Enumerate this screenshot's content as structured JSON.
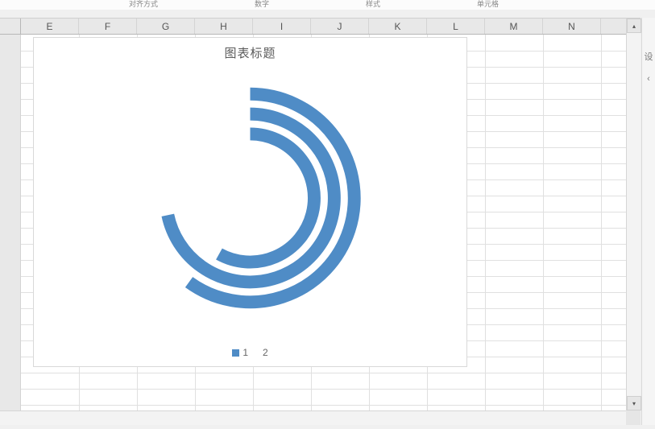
{
  "ribbon_labels": [
    "对齐方式",
    "数字",
    "样式",
    "单元格"
  ],
  "columns": [
    "E",
    "F",
    "G",
    "H",
    "I",
    "J",
    "K",
    "L",
    "M",
    "N"
  ],
  "side_panel": {
    "top_glyph": "设",
    "bottom_glyph": "‹"
  },
  "chart": {
    "title": "图表标题",
    "legend": [
      "1",
      "2"
    ]
  },
  "chart_data": {
    "type": "pie",
    "subtype": "multi-ring-doughnut",
    "title": "图表标题",
    "series_names": [
      "1",
      "2"
    ],
    "rings": [
      {
        "series1_fraction": 0.6,
        "series2_fraction": 0.4
      },
      {
        "series1_fraction": 0.67,
        "series2_fraction": 0.33
      },
      {
        "series1_fraction": 0.58,
        "series2_fraction": 0.42
      }
    ],
    "color_series1": "#4f8cc6",
    "color_series2": "transparent",
    "note": "Three concentric doughnut rings; values estimated from visible arc sweep. Second series not filled."
  }
}
